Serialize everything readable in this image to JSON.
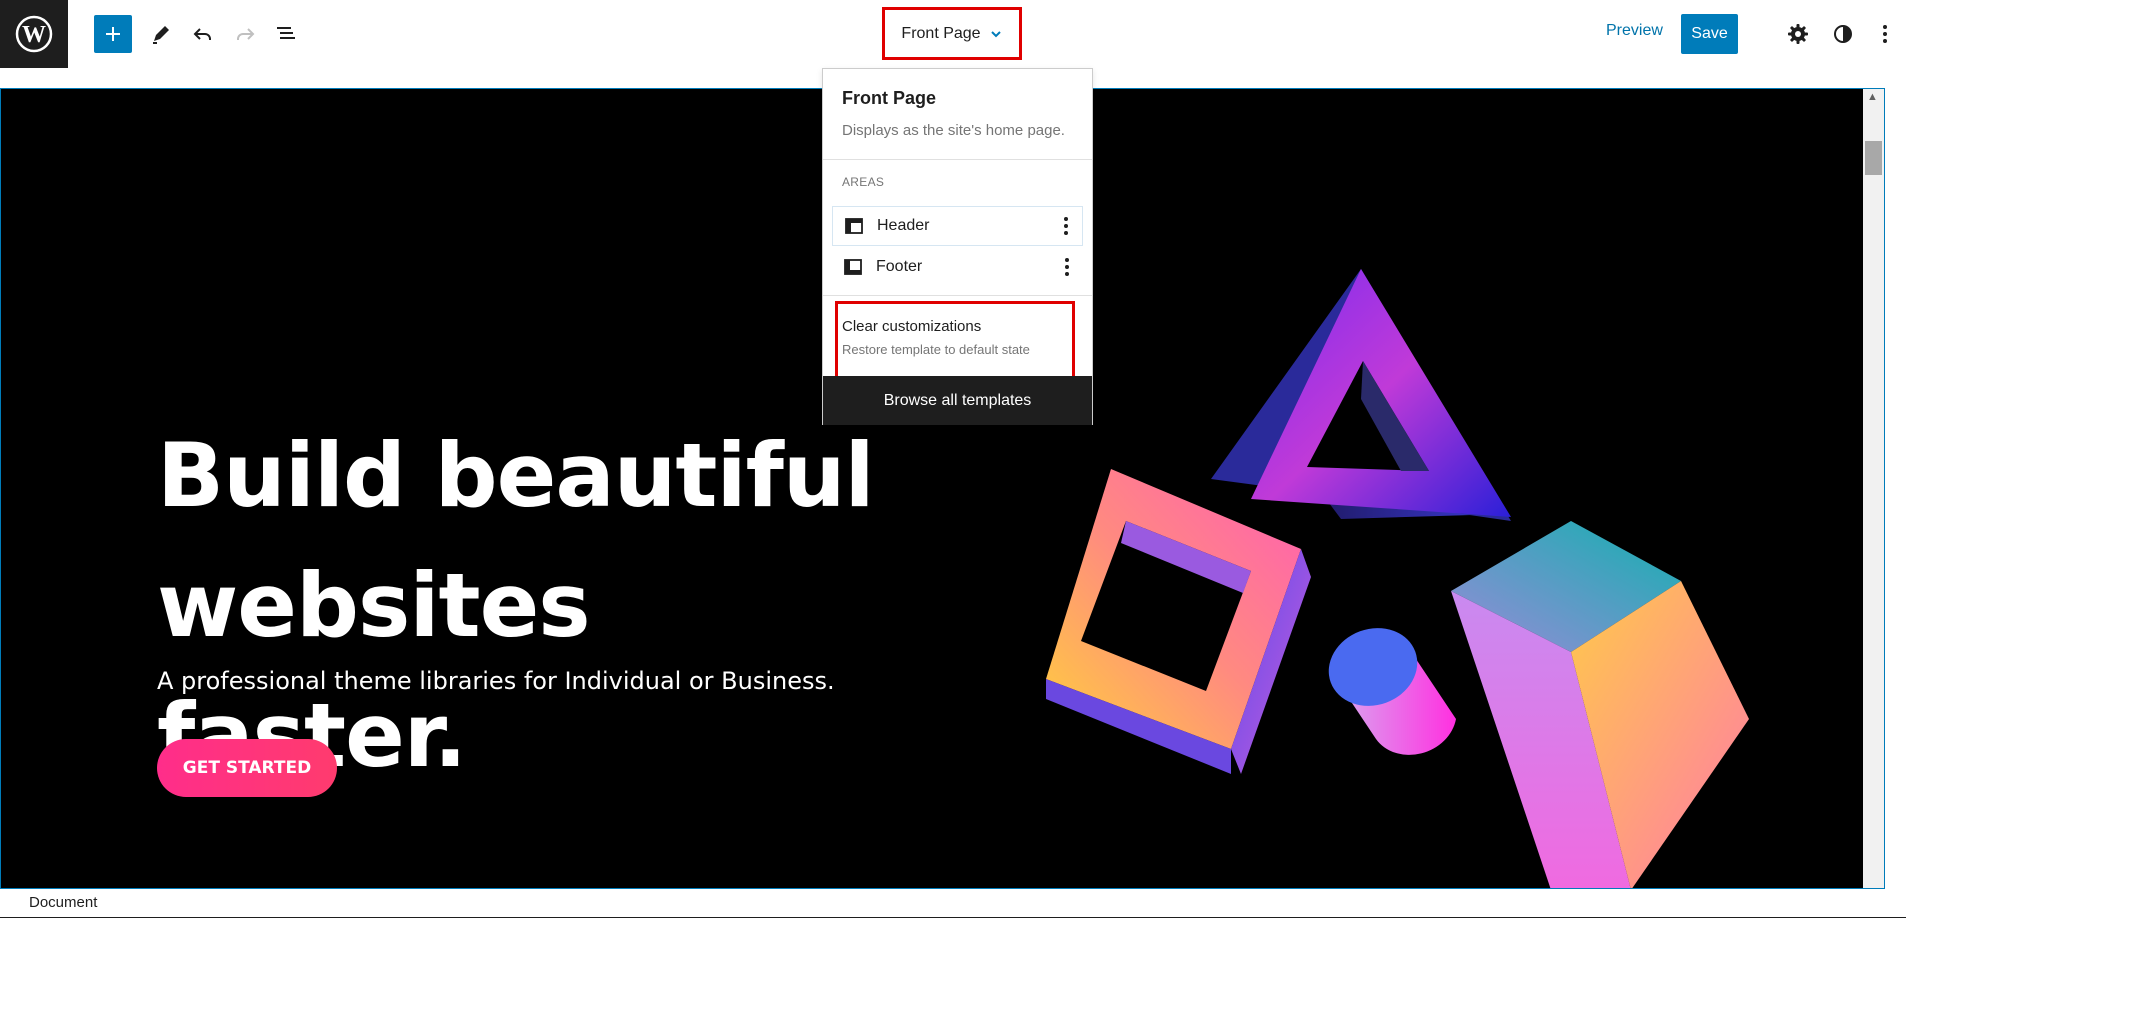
{
  "toolbar": {
    "add_icon": "plus-icon",
    "tools_icon": "pencil-icon",
    "undo_icon": "undo-icon",
    "redo_icon": "redo-icon",
    "list_view_icon": "list-view-icon",
    "document_title": "Front Page",
    "preview_label": "Preview",
    "save_label": "Save",
    "settings_icon": "gear-icon",
    "styles_icon": "half-circle-icon",
    "options_icon": "vertical-ellipsis-icon",
    "accent_color": "#007cba"
  },
  "dropdown": {
    "title": "Front Page",
    "description": "Displays as the site's home page.",
    "areas_heading": "AREAS",
    "areas": [
      {
        "label": "Header",
        "icon": "header-layout-icon"
      },
      {
        "label": "Footer",
        "icon": "footer-layout-icon"
      }
    ],
    "clear_title": "Clear customizations",
    "clear_description": "Restore template to default state",
    "browse_label": "Browse all templates"
  },
  "hero": {
    "title": "Build beautiful websites faster.",
    "subtitle": "A professional theme libraries for Individual or Business.",
    "cta_label": "GET STARTED",
    "cta_color": "#ff2d8a"
  },
  "footer": {
    "breadcrumb": "Document"
  }
}
